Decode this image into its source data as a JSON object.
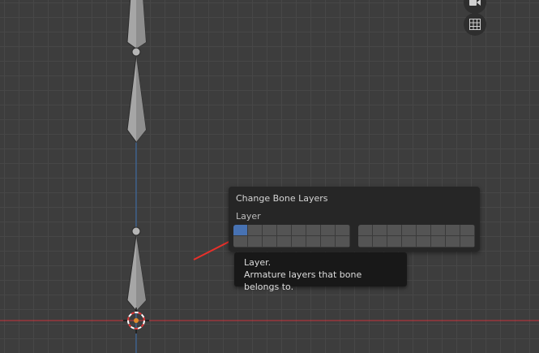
{
  "viewport": {
    "grid_visible": true,
    "colors": {
      "background": "#3d3d3d",
      "grid": "#474747",
      "x_axis": "#c8343c",
      "z_axis": "#3a6fb0",
      "bone": "#a8a8a8",
      "cursor_red": "#e03a3a"
    }
  },
  "nav_gizmo": {
    "icons": [
      "camera-icon",
      "grid-ortho-icon"
    ]
  },
  "popup": {
    "title": "Change Bone Layers",
    "label": "Layer",
    "active_layer": 1,
    "layer_count": 32,
    "active_color": "#4772b3"
  },
  "tooltip": {
    "title": "Layer.",
    "description": "Armature layers that bone belongs to."
  },
  "annotation": {
    "arrow_color": "#e8302a"
  }
}
